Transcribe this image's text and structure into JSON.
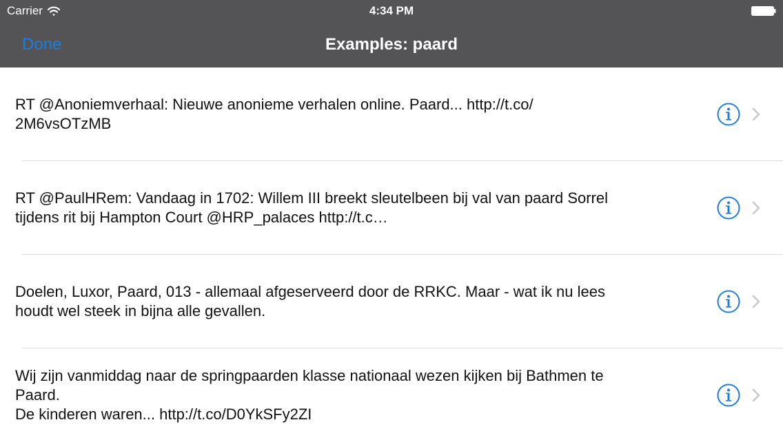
{
  "status_bar": {
    "carrier": "Carrier",
    "time": "4:34 PM",
    "icons": [
      "wifi-icon",
      "battery-icon"
    ]
  },
  "nav": {
    "done_label": "Done",
    "title": "Examples: paard",
    "done_color": "#1a7ee0",
    "bar_color": "#545457"
  },
  "examples": [
    {
      "text": "RT @Anoniemverhaal: Nieuwe anonieme verhalen online. Paard... http://t.co/\n2M6vsOTzMB"
    },
    {
      "text": "RT @PaulHRem: Vandaag in 1702: Willem III breekt sleutelbeen bij val van paard Sorrel\ntijdens rit bij Hampton Court @HRP_palaces http://t.c…"
    },
    {
      "text": "Doelen, Luxor, Paard, 013 - allemaal afgeserveerd door de RRKC. Maar - wat ik nu lees\nhoudt wel steek in bijna alle gevallen."
    },
    {
      "text": "Wij zijn vanmiddag naar de springpaarden klasse nationaal wezen kijken bij Bathmen te\nPaard.\nDe kinderen waren... http://t.co/D0YkSFy2ZI"
    }
  ],
  "row_icons": [
    "info-icon",
    "chevron-right-icon"
  ],
  "accent_color": "#1a7ee0"
}
